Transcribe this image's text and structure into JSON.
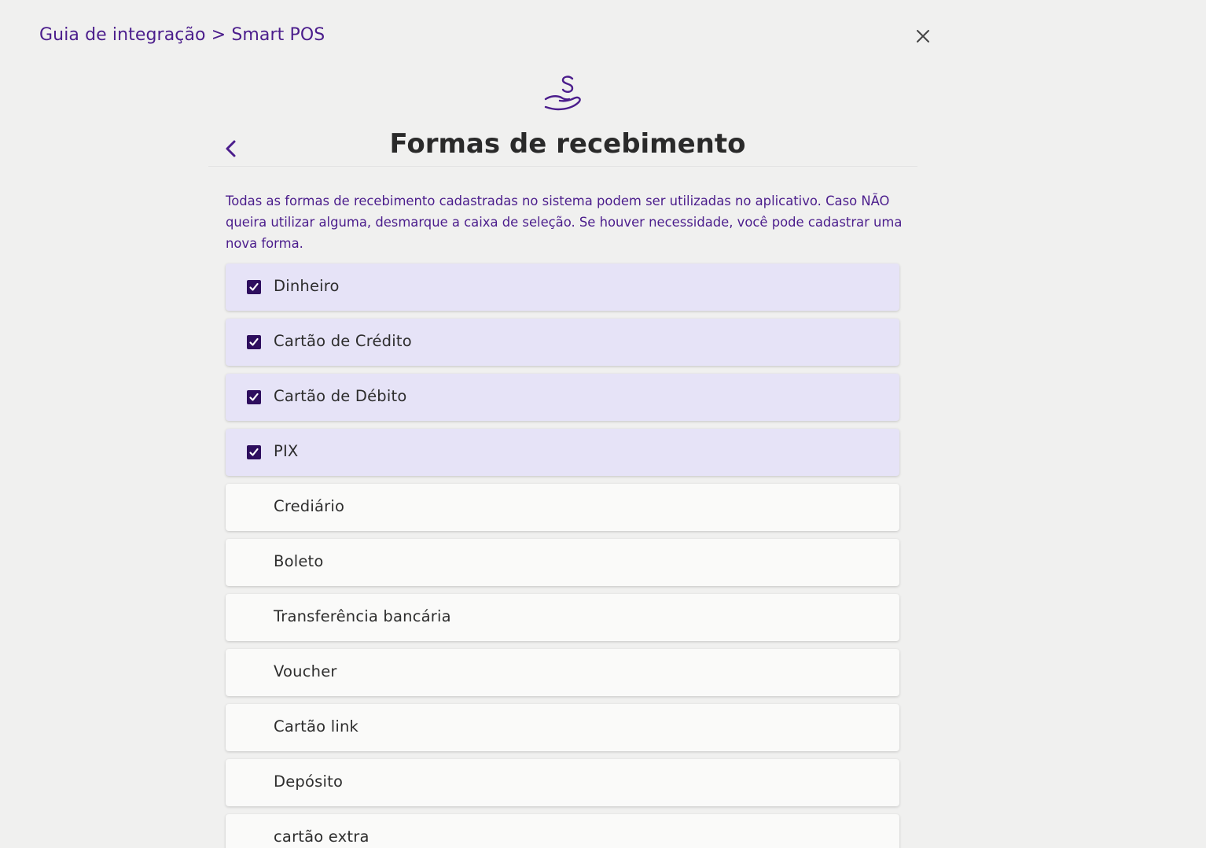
{
  "breadcrumb": "Guia de integração > Smart POS",
  "title": "Formas de recebimento",
  "description": "Todas as formas de recebimento cadastradas no sistema podem ser utilizadas no aplicativo. Caso NÃO queira utilizar alguma, desmarque a caixa de seleção. Se houver necessidade, você pode cadastrar uma nova forma.",
  "icons": {
    "hero": "hand-holding-money-icon",
    "back": "chevron-left-icon",
    "close": "close-icon",
    "check": "checkmark-icon"
  },
  "colors": {
    "accent": "#4b1d8c",
    "checkbox": "#2e0e5e",
    "selected_row": "#e6e3f7",
    "row": "#fafaf9",
    "background": "#f0f0ef"
  },
  "payment_methods": [
    {
      "label": "Dinheiro",
      "checked": true
    },
    {
      "label": "Cartão de Crédito",
      "checked": true
    },
    {
      "label": "Cartão de Débito",
      "checked": true
    },
    {
      "label": "PIX",
      "checked": true
    },
    {
      "label": "Crediário",
      "checked": false
    },
    {
      "label": "Boleto",
      "checked": false
    },
    {
      "label": "Transferência bancária",
      "checked": false
    },
    {
      "label": "Voucher",
      "checked": false
    },
    {
      "label": "Cartão link",
      "checked": false
    },
    {
      "label": "Depósito",
      "checked": false
    },
    {
      "label": "cartão extra",
      "checked": false
    }
  ]
}
